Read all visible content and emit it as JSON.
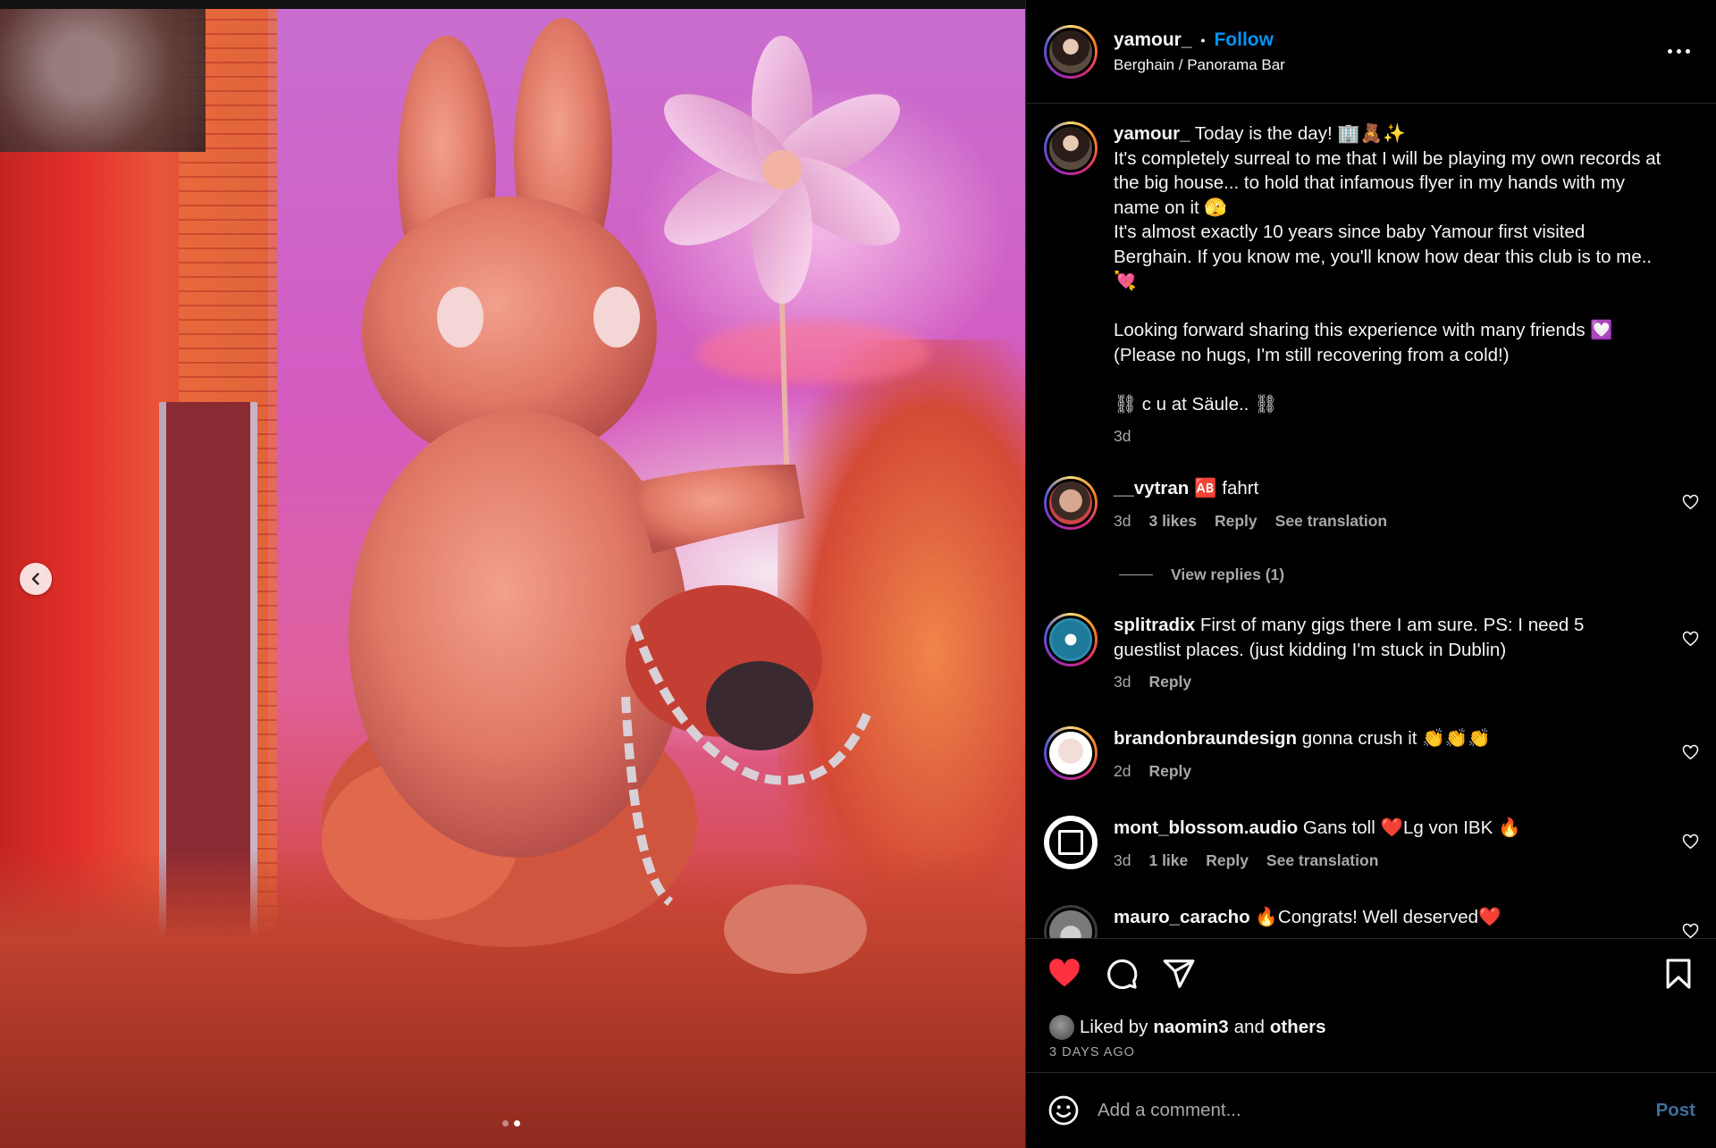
{
  "post": {
    "username": "yamour_",
    "follow_label": "Follow",
    "separator": "•",
    "location": "Berghain / Panorama Bar"
  },
  "caption": {
    "username": "yamour_",
    "text": "Today is the day! 🏢🧸✨\nIt's completely surreal to me that I will be playing my own records at the big house... to hold that infamous flyer in my hands with my name on it 🫣\nIt's almost exactly 10 years since baby Yamour first visited Berghain. If you know me, you'll know how dear this club is to me.. 💘\n\nLooking forward sharing this experience with many friends 💟\n(Please no hugs, I'm still recovering from a cold!)\n\n⛓ c u at Säule.. ⛓",
    "time": "3d"
  },
  "comments": [
    {
      "username": "__vytran",
      "text": "🆎 fahrt",
      "time": "3d",
      "likes": "3 likes",
      "reply": "Reply",
      "translate": "See translation",
      "view_replies": "View replies (1)"
    },
    {
      "username": "splitradix",
      "text": "First of many gigs there I am sure. PS: I need 5 guestlist places. (just kidding I'm stuck in Dublin)",
      "time": "3d",
      "reply": "Reply"
    },
    {
      "username": "brandonbraundesign",
      "text": "gonna crush it 👏👏👏",
      "time": "2d",
      "reply": "Reply"
    },
    {
      "username": "mont_blossom.audio",
      "text": "Gans toll ❤️Lg von IBK 🔥",
      "time": "3d",
      "likes": "1 like",
      "reply": "Reply",
      "translate": "See translation"
    },
    {
      "username": "mauro_caracho",
      "text": "🔥Congrats! Well deserved❤️"
    }
  ],
  "engagement": {
    "liked_by_prefix": "Liked by",
    "liked_by_user": "naomin3",
    "and": "and",
    "others": "others",
    "time_ago": "3 DAYS AGO"
  },
  "composer": {
    "placeholder": "Add a comment...",
    "post_label": "Post"
  },
  "carousel": {
    "total": 2,
    "active_index": 1
  },
  "colors": {
    "accent": "#0095f6",
    "like_red": "#ff3040",
    "muted": "#a8a8a8",
    "background": "#000000"
  },
  "icons": [
    "more-icon",
    "heart-icon",
    "comment-icon",
    "share-icon",
    "bookmark-icon",
    "emoji-icon",
    "chevron-left-icon"
  ]
}
